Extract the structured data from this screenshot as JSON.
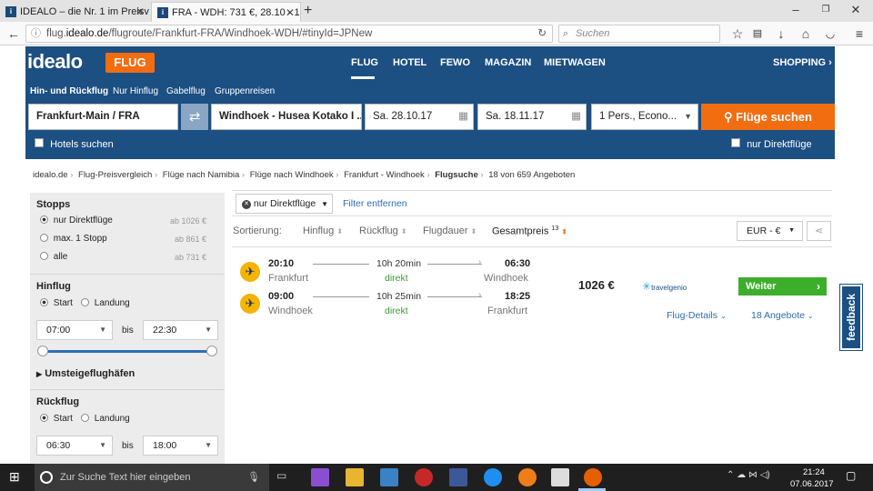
{
  "browser": {
    "tabs": [
      {
        "title": "IDEALO – die Nr. 1 im Preisv",
        "favicon": "i"
      },
      {
        "title": "FRA - WDH: 731 €, 28.10 - 1",
        "favicon": "i"
      }
    ],
    "url_prefix": "flug.",
    "url_domain": "idealo.de",
    "url_path": "/flugroute/Frankfurt-FRA/Windhoek-WDH/#tinyId=JPNew",
    "search_placeholder": "Suchen"
  },
  "site": {
    "logo": "idealo",
    "flug_tag": "FLUG",
    "nav": [
      "FLUG",
      "HOTEL",
      "FEWO",
      "MAGAZIN",
      "MIETWAGEN"
    ],
    "shopping": "SHOPPING"
  },
  "search": {
    "trip_types": [
      "Hin- und Rückflug",
      "Nur Hinflug",
      "Gabelflug",
      "Gruppenreisen"
    ],
    "from": "Frankfurt-Main / FRA",
    "to": "Windhoek - Husea Kotako I ...",
    "depart": "Sa. 28.10.17",
    "return": "Sa. 18.11.17",
    "passengers": "1 Pers., Econo...",
    "submit": "Flüge suchen",
    "hotels_label": "Hotels suchen",
    "direct_label": "nur Direktflüge"
  },
  "breadcrumb": [
    "idealo.de",
    "Flug-Preisvergleich",
    "Flüge nach Namibia",
    "Flüge nach Windhoek",
    "Frankfurt - Windhoek",
    "Flugsuche"
  ],
  "offer_count": "18 von 659 Angeboten",
  "sidebar": {
    "stops_title": "Stopps",
    "stops": [
      {
        "label": "nur Direktflüge",
        "price": "ab 1026 €"
      },
      {
        "label": "max. 1 Stopp",
        "price": "ab 861 €"
      },
      {
        "label": "alle",
        "price": "ab 731 €"
      }
    ],
    "hinflug_title": "Hinflug",
    "rueckflug_title": "Rückflug",
    "start": "Start",
    "landung": "Landung",
    "bis": "bis",
    "hin_from": "07:00",
    "hin_to": "22:30",
    "rueck_from": "06:30",
    "rueck_to": "18:00",
    "umsteige": "Umsteigeflughäfen"
  },
  "filters": {
    "chip": "nur Direktflüge",
    "remove": "Filter entfernen"
  },
  "sort": {
    "label": "Sortierung:",
    "options": [
      "Hinflug",
      "Rückflug",
      "Flugdauer",
      "Gesamtpreis"
    ],
    "gesamt_sup": "13",
    "currency": "EUR - €"
  },
  "result": {
    "out": {
      "dep_time": "20:10",
      "dep_city": "Frankfurt",
      "duration": "10h 20min",
      "stops": "direkt",
      "arr_time": "06:30",
      "arr_city": "Windhoek"
    },
    "back": {
      "dep_time": "09:00",
      "dep_city": "Windhoek",
      "duration": "10h 25min",
      "stops": "direkt",
      "arr_time": "18:25",
      "arr_city": "Frankfurt"
    },
    "price": "1026 €",
    "provider": "travelgenio",
    "cta": "Weiter",
    "details": "Flug-Details",
    "offers": "18 Angebote"
  },
  "feedback": "feedback",
  "taskbar": {
    "search": "Zur Suche Text hier eingeben",
    "time": "21:24",
    "date": "07.06.2017"
  }
}
